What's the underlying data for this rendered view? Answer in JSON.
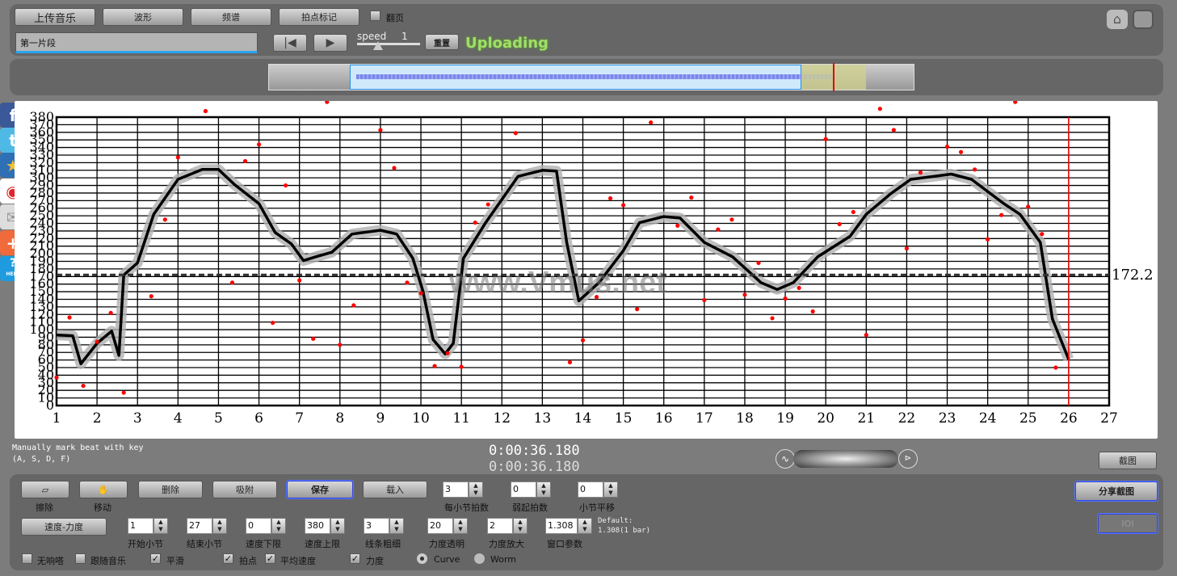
{
  "toolbar": {
    "upload": "上传音乐",
    "waveform": "波形",
    "spectrum": "频谱",
    "beat_mark": "拍点标记",
    "page_turn": "翻页",
    "segment_name": "第一片段",
    "speed_label": "speed",
    "speed_value": "1",
    "reset": "重置",
    "status": "Uploading",
    "home_icon": "home-icon",
    "fullscreen_icon": "fullscreen-icon"
  },
  "social": [
    "facebook-icon",
    "twitter-icon",
    "favorite-icon",
    "weibo-icon",
    "mail-icon",
    "plus-icon",
    "help-icon"
  ],
  "social_help_text": "HELP",
  "hint": {
    "line1": "Manually mark beat with key",
    "line2": "(A, S, D, F)"
  },
  "time": {
    "current": "0:00:36.180",
    "total": "0:00:36.180"
  },
  "screenshot_btn": "截图",
  "watermark": "www.Vmus.net",
  "controls": {
    "erase": "擦除",
    "move": "移动",
    "delete": "删除",
    "snap": "吸附",
    "save": "保存",
    "load": "载入",
    "beats_per_bar": {
      "value": "3",
      "label": "每小节拍数"
    },
    "pickup_beats": {
      "value": "0",
      "label": "弱起拍数"
    },
    "bar_shift": {
      "value": "0",
      "label": "小节平移"
    },
    "tempo_dynamics": "速度-力度",
    "start_bar": {
      "value": "1",
      "label": "开始小节"
    },
    "end_bar": {
      "value": "27",
      "label": "结束小节"
    },
    "tempo_min": {
      "value": "0",
      "label": "速度下限"
    },
    "tempo_max": {
      "value": "380",
      "label": "速度上限"
    },
    "line_width": {
      "value": "3",
      "label": "线条粗细"
    },
    "dyn_opacity": {
      "value": "20",
      "label": "力度透明"
    },
    "dyn_scale": {
      "value": "2",
      "label": "力度放大"
    },
    "window_param": {
      "value": "1.308",
      "label": "窗口参数"
    },
    "default_note1": "Default:",
    "default_note2": "1.308(1 bar)",
    "no_metronome": "无响嗒",
    "follow_music": "跟随音乐",
    "smooth": "平滑",
    "beats": "拍点",
    "avg_tempo": "平均速度",
    "dynamics": "力度",
    "curve": "Curve",
    "worm": "Worm",
    "smooth_checked": true,
    "beats_checked": true,
    "avg_checked": true,
    "dynamics_checked": true,
    "mode": "Curve",
    "share_screenshot": "分享截图",
    "disabled_btn": "IOI"
  },
  "chart_data": {
    "type": "line",
    "xlim": [
      1,
      27
    ],
    "ylim": [
      0,
      380
    ],
    "x_ticks": [
      1,
      2,
      3,
      4,
      5,
      6,
      7,
      8,
      9,
      10,
      11,
      12,
      13,
      14,
      15,
      16,
      17,
      18,
      19,
      20,
      21,
      22,
      23,
      24,
      25,
      26,
      27
    ],
    "y_ticks": [
      0,
      10,
      20,
      30,
      40,
      50,
      60,
      70,
      80,
      90,
      100,
      110,
      120,
      130,
      140,
      150,
      160,
      170,
      180,
      190,
      200,
      210,
      220,
      230,
      240,
      250,
      260,
      270,
      280,
      290,
      300,
      310,
      320,
      330,
      340,
      350,
      360,
      370,
      380
    ],
    "grid": true,
    "average": {
      "value": 172.2,
      "label": "172.2"
    },
    "cursor_x": 26,
    "curve": [
      [
        1,
        93
      ],
      [
        1.4,
        92
      ],
      [
        1.6,
        55
      ],
      [
        2,
        82
      ],
      [
        2.36,
        98
      ],
      [
        2.54,
        66
      ],
      [
        2.66,
        172
      ],
      [
        3,
        188
      ],
      [
        3.4,
        252
      ],
      [
        4,
        298
      ],
      [
        4.6,
        311
      ],
      [
        5,
        311
      ],
      [
        5.4,
        291
      ],
      [
        6,
        266
      ],
      [
        6.4,
        228
      ],
      [
        6.8,
        213
      ],
      [
        7.1,
        191
      ],
      [
        7.4,
        196
      ],
      [
        7.8,
        202
      ],
      [
        8.3,
        226
      ],
      [
        9,
        231
      ],
      [
        9.4,
        226
      ],
      [
        9.8,
        194
      ],
      [
        10.05,
        151
      ],
      [
        10.3,
        87
      ],
      [
        10.6,
        68
      ],
      [
        10.8,
        82
      ],
      [
        11.05,
        194
      ],
      [
        11.6,
        241
      ],
      [
        12.4,
        302
      ],
      [
        13,
        310
      ],
      [
        13.35,
        309
      ],
      [
        13.6,
        215
      ],
      [
        13.9,
        138
      ],
      [
        14.4,
        162
      ],
      [
        15,
        204
      ],
      [
        15.4,
        241
      ],
      [
        16,
        249
      ],
      [
        16.4,
        247
      ],
      [
        17,
        215
      ],
      [
        17.7,
        196
      ],
      [
        18.4,
        162
      ],
      [
        18.8,
        153
      ],
      [
        19.2,
        162
      ],
      [
        19.8,
        196
      ],
      [
        20.6,
        223
      ],
      [
        21,
        252
      ],
      [
        21.6,
        279
      ],
      [
        22.1,
        298
      ],
      [
        23.1,
        305
      ],
      [
        23.6,
        298
      ],
      [
        24.4,
        266
      ],
      [
        24.8,
        252
      ],
      [
        25.3,
        215
      ],
      [
        25.6,
        114
      ],
      [
        26,
        61
      ]
    ],
    "beats": [
      [
        1,
        37
      ],
      [
        1.32,
        116
      ],
      [
        1.66,
        26
      ],
      [
        2,
        84
      ],
      [
        2.34,
        122
      ],
      [
        2.66,
        17
      ],
      [
        3.34,
        144
      ],
      [
        3.68,
        245
      ],
      [
        4,
        327
      ],
      [
        4.68,
        388
      ],
      [
        5.34,
        162
      ],
      [
        5.66,
        322
      ],
      [
        6,
        344
      ],
      [
        6.34,
        109
      ],
      [
        6.66,
        290
      ],
      [
        7,
        165
      ],
      [
        7.34,
        88
      ],
      [
        7.68,
        400
      ],
      [
        8,
        80
      ],
      [
        8.34,
        132
      ],
      [
        9,
        363
      ],
      [
        9.34,
        313
      ],
      [
        9.66,
        162
      ],
      [
        10,
        148
      ],
      [
        10.34,
        52
      ],
      [
        10.66,
        69
      ],
      [
        11,
        51
      ],
      [
        11.34,
        241
      ],
      [
        11.66,
        265
      ],
      [
        12.34,
        359
      ],
      [
        13.68,
        57
      ],
      [
        14,
        86
      ],
      [
        14.34,
        143
      ],
      [
        14.68,
        273
      ],
      [
        15,
        264
      ],
      [
        15.34,
        127
      ],
      [
        15.68,
        373
      ],
      [
        16.34,
        237
      ],
      [
        16.68,
        274
      ],
      [
        17,
        139
      ],
      [
        17.34,
        232
      ],
      [
        17.68,
        245
      ],
      [
        18,
        146
      ],
      [
        18.34,
        188
      ],
      [
        18.68,
        115
      ],
      [
        19,
        141
      ],
      [
        19.34,
        155
      ],
      [
        19.68,
        124
      ],
      [
        20,
        351
      ],
      [
        20.34,
        239
      ],
      [
        20.68,
        255
      ],
      [
        21,
        93
      ],
      [
        21.34,
        391
      ],
      [
        21.68,
        363
      ],
      [
        22,
        207
      ],
      [
        22.34,
        307
      ],
      [
        23,
        341
      ],
      [
        23.34,
        334
      ],
      [
        23.68,
        311
      ],
      [
        24,
        219
      ],
      [
        24.34,
        251
      ],
      [
        24.68,
        400
      ],
      [
        25,
        262
      ],
      [
        25.34,
        226
      ],
      [
        25.68,
        50
      ]
    ],
    "colors": {
      "curve": "#000000",
      "band": "#b0b0b0",
      "beats": "#ff0000",
      "average": "#333333",
      "cursor": "#ff0000"
    }
  }
}
